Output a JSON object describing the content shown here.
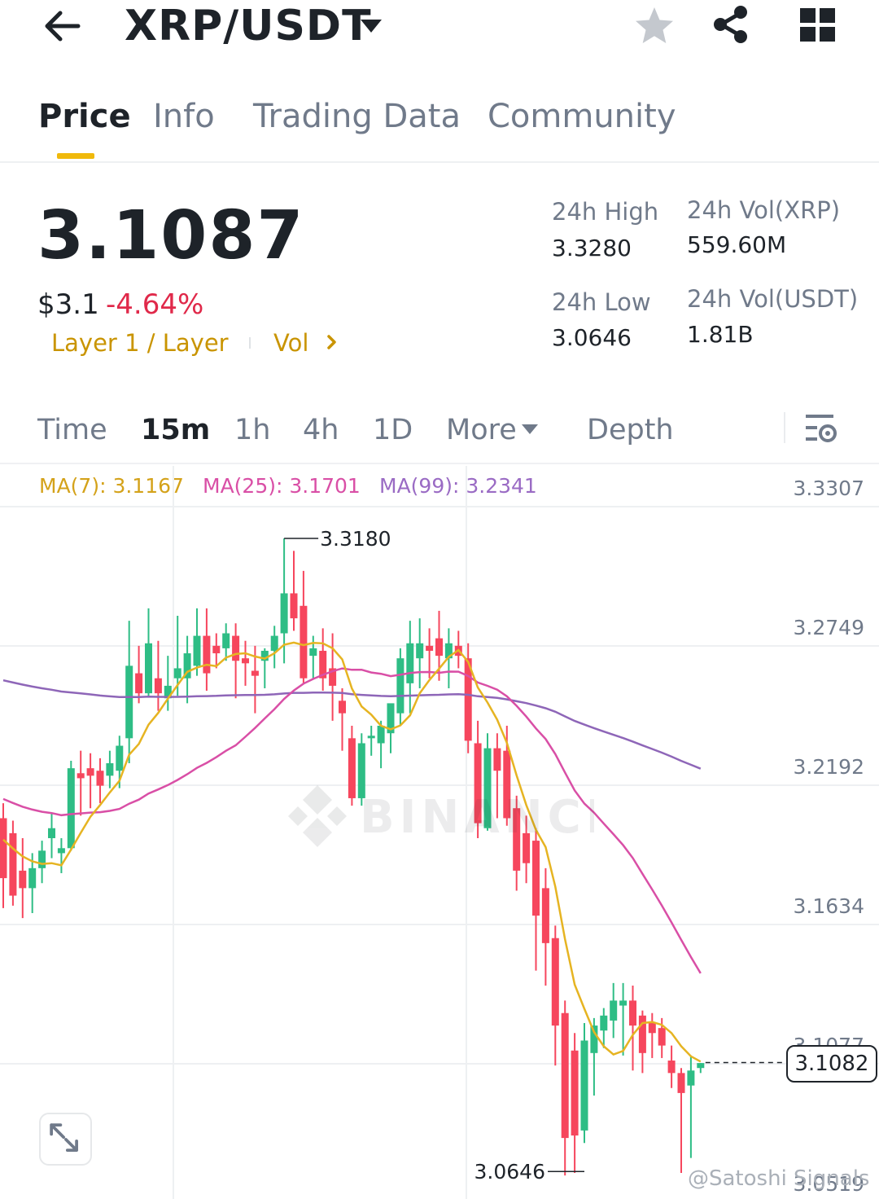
{
  "header": {
    "pair": "XRP/USDT",
    "icons": [
      "back-arrow-icon",
      "caret-down-icon",
      "star-icon",
      "share-icon",
      "grid-icon"
    ]
  },
  "tabs": [
    {
      "label": "Price",
      "active": true
    },
    {
      "label": "Info"
    },
    {
      "label": "Trading Data"
    },
    {
      "label": "Community"
    }
  ],
  "price": {
    "last": "3.1087",
    "usd": "$3.1",
    "change": "-4.64%",
    "tag_layer": "Layer 1 / Layer",
    "tag_vol": "Vol"
  },
  "stats": {
    "high_label": "24h High",
    "high_value": "3.3280",
    "low_label": "24h Low",
    "low_value": "3.0646",
    "vol_base_label": "24h Vol(XRP)",
    "vol_base_value": "559.60M",
    "vol_quote_label": "24h Vol(USDT)",
    "vol_quote_value": "1.81B"
  },
  "intervals": [
    {
      "label": "Time"
    },
    {
      "label": "15m",
      "active": true
    },
    {
      "label": "1h"
    },
    {
      "label": "4h"
    },
    {
      "label": "1D"
    },
    {
      "label": "More"
    },
    {
      "label": "Depth"
    }
  ],
  "ma_legend": {
    "ma7": "MA(7): 3.1167",
    "ma25": "MA(25): 3.1701",
    "ma99": "MA(99): 3.2341"
  },
  "chart": {
    "y_ticks": [
      "3.3307",
      "3.2749",
      "3.2192",
      "3.1634",
      "3.1077",
      "3.0519"
    ],
    "high_marker": "3.3180",
    "low_marker": "3.0646",
    "current_price": "3.1082",
    "watermark": "BINANCE",
    "colors": {
      "up": "#2ebd85",
      "down": "#f6465d",
      "ma7": "#e6b422",
      "ma25": "#d94fa6",
      "ma99": "#8e66b8"
    }
  },
  "signature": "@Satoshi Signals"
}
